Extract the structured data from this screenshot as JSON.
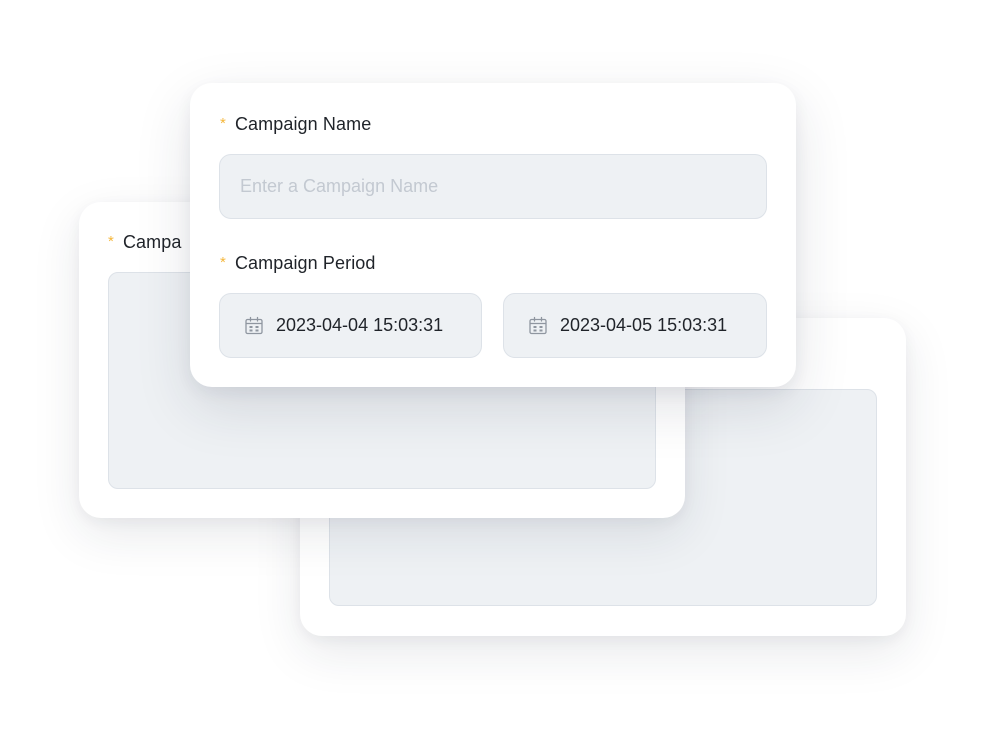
{
  "form": {
    "campaign_name": {
      "required_mark": "*",
      "label": "Campaign Name",
      "value": "",
      "placeholder": "Enter a Campaign Name"
    },
    "campaign_period": {
      "required_mark": "*",
      "label": "Campaign Period",
      "start": {
        "icon": "calendar-icon",
        "value": "2023-04-04 15:03:31"
      },
      "end": {
        "icon": "calendar-icon",
        "value": "2023-04-05 15:03:31"
      }
    }
  },
  "background_card": {
    "required_mark": "*",
    "label_partial": "Campa"
  },
  "colors": {
    "required": "#f5b73b",
    "input_bg": "#eef1f4",
    "input_border": "#dde2e8",
    "text": "#1f2329",
    "placeholder": "#c3c9d1"
  }
}
